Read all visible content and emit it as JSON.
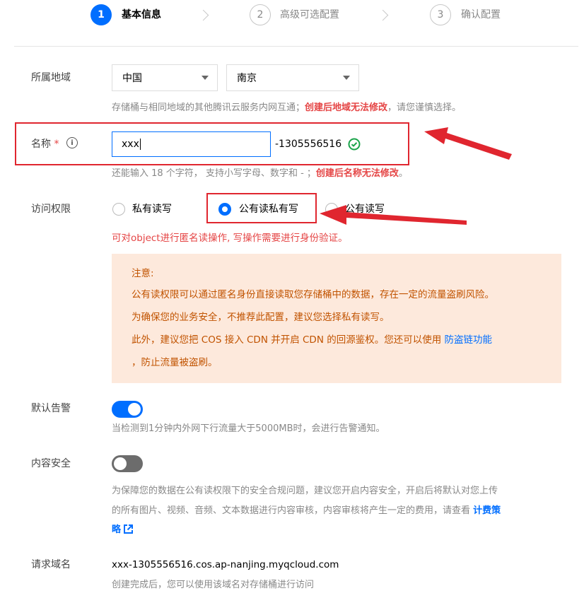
{
  "steps": [
    {
      "num": "1",
      "label": "基本信息"
    },
    {
      "num": "2",
      "label": "高级可选配置"
    },
    {
      "num": "3",
      "label": "确认配置"
    }
  ],
  "region": {
    "label": "所属地域",
    "country": "中国",
    "city": "南京",
    "hint": "存储桶与相同地域的其他腾讯云服务内网互通；",
    "hint_warn": "创建后地域无法修改",
    "hint_tail": "，请您谨慎选择。"
  },
  "name": {
    "label": "名称",
    "required": "*",
    "value": "xxx",
    "suffix": "-1305556516",
    "hint": "还能输入 18 个字符， 支持小写字母、数字和 - ；",
    "hint_warn": "创建后名称无法修改",
    "hint_tail": "。"
  },
  "access": {
    "label": "访问权限",
    "options": [
      "私有读写",
      "公有读私有写",
      "公有读写"
    ],
    "selected": 1,
    "desc": "可对object进行匿名读操作, 写操作需要进行身份验证。"
  },
  "notice": {
    "title": "注意:",
    "line1": "公有读权限可以通过匿名身份直接读取您存储桶中的数据，存在一定的流量盗刷风险。",
    "line2": "为确保您的业务安全，不推荐此配置，建议您选择私有读写。",
    "line3": "此外，建议您把 COS 接入 CDN 并开启 CDN 的回源鉴权。您还可以使用 ",
    "line3_link": "防盗链功能",
    "line4": "，防止流量被盗刷。"
  },
  "alarm": {
    "label": "默认告警",
    "enabled": true,
    "hint": "当检测到1分钟内外网下行流量大于5000MB时，会进行告警通知。"
  },
  "content_security": {
    "label": "内容安全",
    "enabled": false,
    "hint1": "为保障您的数据在公有读权限下的安全合规问题，建议您开启内容安全，开启后将默认对您上传",
    "hint2": "的所有图片、视频、音频、文本数据进行内容审核，内容审核将产生一定的费用，请查看 ",
    "hint2_link": "计费策",
    "hint3_link": "略"
  },
  "domain": {
    "label": "请求域名",
    "value": "xxx-1305556516.cos.ap-nanjing.myqcloud.com",
    "hint": "创建完成后，您可以使用该域名对存储桶进行访问"
  },
  "colors": {
    "primary": "#006eff",
    "warn": "#e54545",
    "annotation": "#e0262f",
    "notice_bg": "#fde9dc",
    "notice_text": "#c15300",
    "success": "#1aa34a"
  }
}
